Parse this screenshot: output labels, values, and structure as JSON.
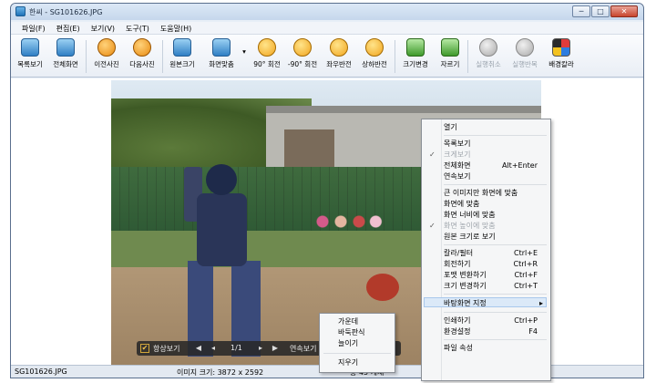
{
  "window": {
    "title": "한씨 - SG101626.JPG",
    "minimize": "─",
    "maximize": "□",
    "close": "✕"
  },
  "menu": [
    "파일(F)",
    "편집(E)",
    "보기(V)",
    "도구(T)",
    "도움말(H)"
  ],
  "toolbar": [
    {
      "label": "목록보기",
      "icon": "list-view-icon",
      "style": "blue",
      "disabled": false
    },
    {
      "label": "전체화면",
      "icon": "fullscreen-icon",
      "style": "blue",
      "disabled": false
    },
    {
      "label": "이전사진",
      "icon": "previous-arrow-icon",
      "style": "orange",
      "disabled": false
    },
    {
      "label": "다음사진",
      "icon": "next-arrow-icon",
      "style": "orange",
      "disabled": false
    },
    {
      "label": "원본크기",
      "icon": "original-size-icon",
      "style": "blue",
      "disabled": false
    },
    {
      "label": "화면맞춤",
      "icon": "fit-screen-icon",
      "style": "blue",
      "disabled": false
    },
    {
      "label": "90° 회전",
      "icon": "rotate-right-icon",
      "style": "rot",
      "disabled": false
    },
    {
      "label": "-90° 회전",
      "icon": "rotate-left-icon",
      "style": "rot",
      "disabled": false
    },
    {
      "label": "좌우반전",
      "icon": "flip-horizontal-icon",
      "style": "rot",
      "disabled": false
    },
    {
      "label": "상하반전",
      "icon": "flip-vertical-icon",
      "style": "rot",
      "disabled": false
    },
    {
      "label": "크기변경",
      "icon": "resize-icon",
      "style": "green",
      "disabled": false
    },
    {
      "label": "자르기",
      "icon": "crop-icon",
      "style": "green",
      "disabled": false
    },
    {
      "label": "실행취소",
      "icon": "undo-icon",
      "style": "gray",
      "disabled": true
    },
    {
      "label": "실행반복",
      "icon": "redo-icon",
      "style": "gray",
      "disabled": true
    },
    {
      "label": "배경칼라",
      "icon": "background-color-icon",
      "style": "color",
      "disabled": false
    }
  ],
  "navbar": {
    "always_show": "항상보기",
    "check": "✔",
    "page": "1/1",
    "continuous": "연속보기"
  },
  "status": {
    "filename": "SG101626.JPG",
    "size": "이미지 크기: 3872 x 2592",
    "count": "총 45 개체"
  },
  "context_menu": {
    "open": "열기",
    "list_view": "목록보기",
    "big_view": "크게보기",
    "fullscreen": "전체화면",
    "fullscreen_sc": "Alt+Enter",
    "slideshow": "연속보기",
    "fit_large": "큰 이미지만 화면에 맞춤",
    "fit_screen": "화면에 맞춤",
    "fit_width": "화면 너비에 맞춤",
    "fit_height": "화면 높이에 맞춤",
    "original_size": "원본 크기로 보기",
    "color_filter": "칼라/필터",
    "color_filter_sc": "Ctrl+E",
    "rotate": "회전하기",
    "rotate_sc": "Ctrl+R",
    "format_convert": "포맷 변환하기",
    "format_convert_sc": "Ctrl+F",
    "resize": "크기 변경하기",
    "resize_sc": "Ctrl+T",
    "wallpaper": "바탕화면 지정",
    "wallpaper_arrow": "▸",
    "print": "인쇄하기",
    "print_sc": "Ctrl+P",
    "settings": "환경설정",
    "settings_sc": "F4",
    "properties": "파일 속성",
    "check": "✓"
  },
  "submenu": {
    "center": "가운데",
    "tile": "바둑판식",
    "stretch": "늘이기",
    "remove": "지우기"
  }
}
